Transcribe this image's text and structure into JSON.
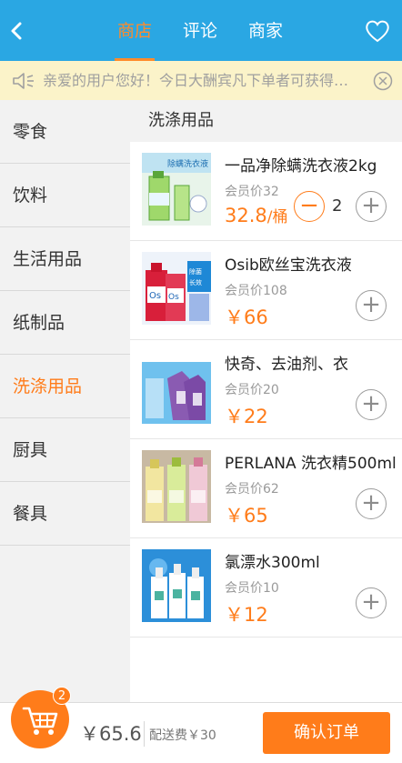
{
  "header": {
    "tabs": [
      {
        "label": "商店",
        "active": true
      },
      {
        "label": "评论",
        "active": false
      },
      {
        "label": "商家",
        "active": false
      }
    ],
    "icons": {
      "back": "back-arrow-icon",
      "favorite": "heart-icon"
    },
    "colors": {
      "bar": "#2aa7e3",
      "accent": "#ff8b2b"
    }
  },
  "notice": {
    "text": "亲爱的用户您好！今日大酬宾凡下单者可获得…",
    "icons": {
      "speaker": "speaker-icon",
      "close": "close-circle-icon"
    }
  },
  "sidebar": {
    "items": [
      {
        "label": "零食",
        "active": false
      },
      {
        "label": "饮料",
        "active": false
      },
      {
        "label": "生活用品",
        "active": false
      },
      {
        "label": "纸制品",
        "active": false
      },
      {
        "label": "洗涤用品",
        "active": true
      },
      {
        "label": "厨具",
        "active": false
      },
      {
        "label": "餐具",
        "active": false
      }
    ]
  },
  "main": {
    "section_title": "洗涤用品",
    "products": [
      {
        "name": "一品净除螨洗衣液2kg",
        "member_price": "会员价32",
        "price": "32.8",
        "unit": "/桶",
        "quantity": "2",
        "minus": "−",
        "plus": "+",
        "image_text": "除螨洗衣液"
      },
      {
        "name": "Osib欧丝宝洗衣液",
        "member_price": "会员价108",
        "price": "￥66",
        "plus": "+",
        "image_text": "除菌\n长效"
      },
      {
        "name": "快奇、去油剂、衣",
        "member_price": "会员价20",
        "price": "￥22",
        "plus": "+",
        "image_text": ""
      },
      {
        "name": "PERLANA 洗衣精500ml",
        "member_price": "会员价62",
        "price": "￥65",
        "plus": "+",
        "image_text": ""
      },
      {
        "name": "氯漂水300ml",
        "member_price": "会员价10",
        "price": "￥12",
        "plus": "+",
        "image_text": ""
      }
    ]
  },
  "bottom": {
    "cart_count": "2",
    "total": "￥65.6",
    "delivery": "配送费￥30",
    "confirm": "确认订单",
    "icons": {
      "cart": "cart-icon"
    },
    "colors": {
      "accent": "#ff7c1a"
    }
  }
}
